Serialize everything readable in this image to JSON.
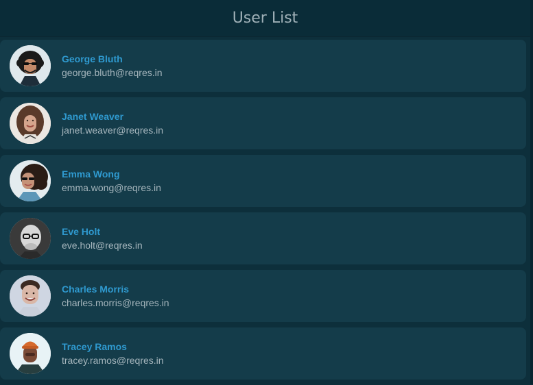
{
  "header": {
    "title": "User List"
  },
  "users": [
    {
      "name": "George Bluth",
      "email": "george.bluth@reqres.in",
      "avatar": "portrait-man-sunglasses-curly-hair",
      "avatar_bg": "#dfe8ec",
      "skin": "#c48a69",
      "hair": "#1a1a1a",
      "shirt": "#1e2e3a"
    },
    {
      "name": "Janet Weaver",
      "email": "janet.weaver@reqres.in",
      "avatar": "portrait-woman-curly-hair",
      "avatar_bg": "#ece7e2",
      "skin": "#d5a58d",
      "hair": "#5a3a2a",
      "shirt": "#e9e4df"
    },
    {
      "name": "Emma Wong",
      "email": "emma.wong@reqres.in",
      "avatar": "portrait-woman-sunglasses-curly-hair",
      "avatar_bg": "#e4ecef",
      "skin": "#c59278",
      "hair": "#2a1c15",
      "shirt": "#5d97b8"
    },
    {
      "name": "Eve Holt",
      "email": "eve.holt@reqres.in",
      "avatar": "portrait-bald-man-glasses",
      "avatar_bg": "#3a3a3a",
      "skin": "#d8d8d8",
      "hair": "#bcbcbc",
      "shirt": "#2a2a2a"
    },
    {
      "name": "Charles Morris",
      "email": "charles.morris@reqres.in",
      "avatar": "portrait-man-smiling",
      "avatar_bg": "#cfd6e2",
      "skin": "#d9b7a7",
      "hair": "#3b2a22",
      "shirt": "#c9cfda"
    },
    {
      "name": "Tracey Ramos",
      "email": "tracey.ramos@reqres.in",
      "avatar": "portrait-man-orange-beanie",
      "avatar_bg": "#e8f3f6",
      "skin": "#7a4a36",
      "hair": "#d66a2d",
      "shirt": "#273e3f"
    }
  ]
}
